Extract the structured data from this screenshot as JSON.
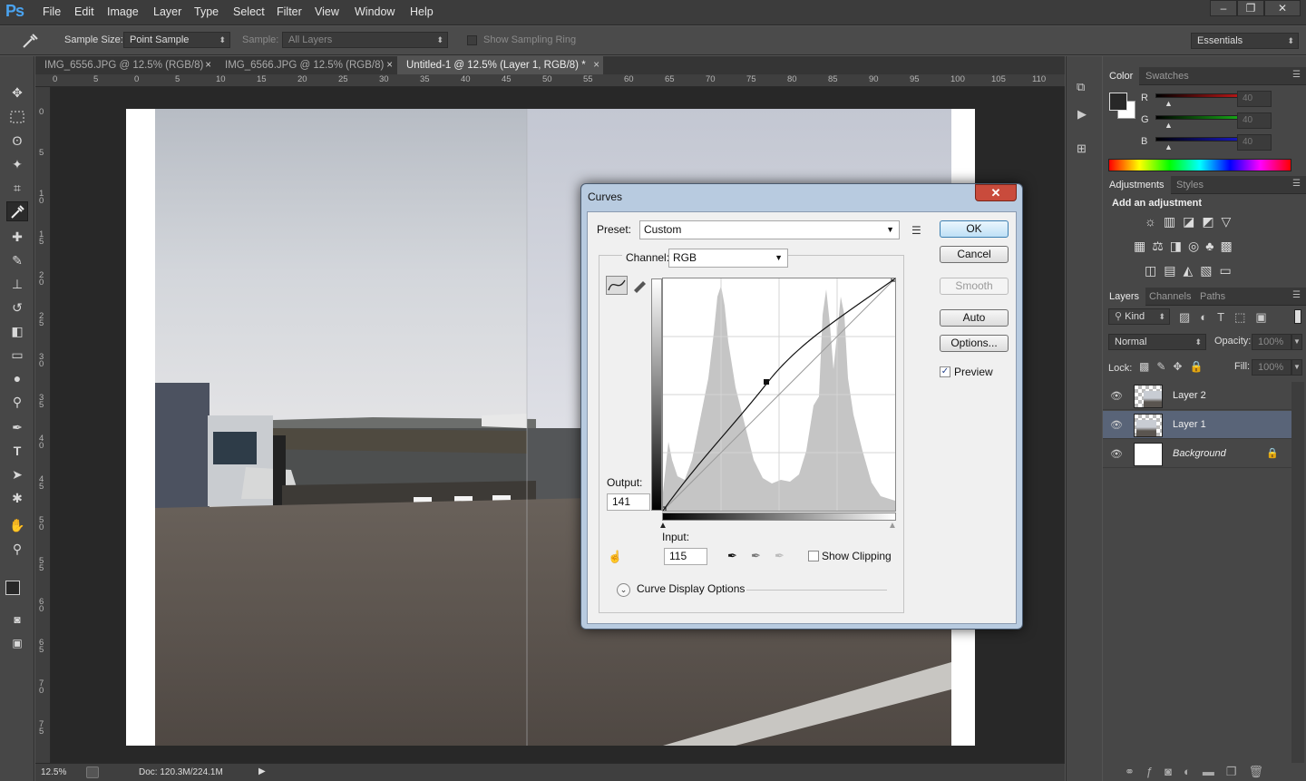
{
  "app": {
    "logo": "Ps"
  },
  "menu": [
    "File",
    "Edit",
    "Image",
    "Layer",
    "Type",
    "Select",
    "Filter",
    "View",
    "Window",
    "Help"
  ],
  "window_controls": {
    "minimize": "‒",
    "restore": "❐",
    "close": "✕"
  },
  "options_bar": {
    "sample_size_label": "Sample Size:",
    "sample_size_value": "Point Sample",
    "sample_label": "Sample:",
    "sample_value": "All Layers",
    "show_sampling_ring": "Show Sampling Ring",
    "workspace": "Essentials"
  },
  "tabs": [
    {
      "label": "IMG_6556.JPG @ 12.5% (RGB/8)",
      "close": "×"
    },
    {
      "label": "IMG_6566.JPG @ 12.5% (RGB/8)",
      "close": "×"
    },
    {
      "label": "Untitled-1 @ 12.5% (Layer 1, RGB/8) *",
      "close": "×"
    }
  ],
  "ruler": {
    "h": [
      "0",
      "5",
      "0",
      "5",
      "10",
      "15",
      "20",
      "25",
      "30",
      "35",
      "40",
      "45",
      "50",
      "55",
      "60",
      "65",
      "70",
      "75",
      "80",
      "85",
      "90",
      "95",
      "100",
      "105",
      "110"
    ],
    "v": [
      "0",
      "5",
      "1\n0",
      "1\n5",
      "2\n0",
      "2\n5",
      "3\n0",
      "3\n5",
      "4\n0",
      "4\n5",
      "5\n0",
      "5\n5",
      "6\n0",
      "6\n5",
      "7\n0",
      "7\n5"
    ]
  },
  "status": {
    "zoom": "12.5%",
    "doc": "Doc: 120.3M/224.1M",
    "arrow": "▶"
  },
  "color_panel": {
    "tabs": [
      "Color",
      "Swatches"
    ],
    "channels": [
      {
        "label": "R",
        "value": "40",
        "gradient": "#c01818"
      },
      {
        "label": "G",
        "value": "40",
        "gradient": "#18b018"
      },
      {
        "label": "B",
        "value": "40",
        "gradient": "#1818c8"
      }
    ]
  },
  "adjustments_panel": {
    "tabs": [
      "Adjustments",
      "Styles"
    ],
    "heading": "Add an adjustment"
  },
  "layers_panel": {
    "tabs": [
      "Layers",
      "Channels",
      "Paths"
    ],
    "kind": "Kind",
    "blend_mode": "Normal",
    "opacity_label": "Opacity:",
    "opacity_value": "100%",
    "lock_label": "Lock:",
    "fill_label": "Fill:",
    "fill_value": "100%",
    "layers": [
      {
        "name": "Layer 2"
      },
      {
        "name": "Layer 1"
      },
      {
        "name": "Background"
      }
    ]
  },
  "curves_dialog": {
    "title": "Curves",
    "close": "✕",
    "preset_label": "Preset:",
    "preset_value": "Custom",
    "channel_label": "Channel:",
    "channel_value": "RGB",
    "output_label": "Output:",
    "output_value": "141",
    "input_label": "Input:",
    "input_value": "115",
    "show_clipping": "Show Clipping",
    "curve_display_options": "Curve Display Options",
    "buttons": {
      "ok": "OK",
      "cancel": "Cancel",
      "smooth": "Smooth",
      "auto": "Auto",
      "options": "Options..."
    },
    "preview_label": "Preview",
    "preview_checked": "✓"
  }
}
